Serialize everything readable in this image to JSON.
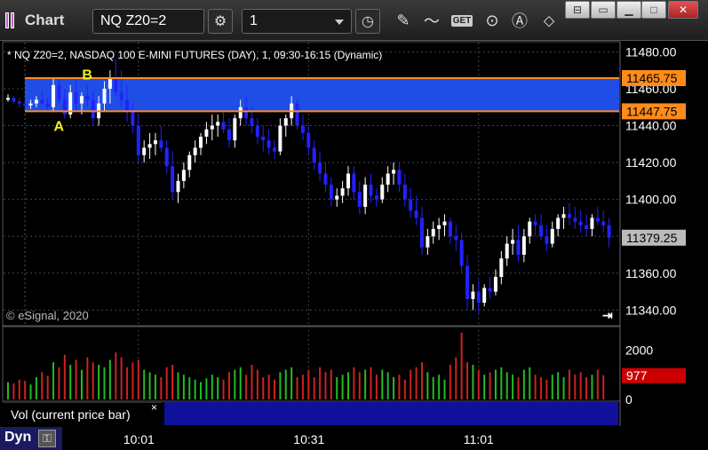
{
  "window": {
    "title": "Chart"
  },
  "toolbar": {
    "symbol": "NQ Z20=2",
    "interval": "1",
    "icons": [
      "settings-gear-icon",
      "clock-icon",
      "pencil-draw-icon",
      "study-icon",
      "get-icon",
      "play-icon",
      "autoscale-icon",
      "pointer-tool-icon"
    ],
    "get_label": "GET"
  },
  "window_controls": [
    "restore-icon",
    "minimize-icon",
    "maximize-icon",
    "close-icon"
  ],
  "chart_header": "* NQ Z20=2, NASDAQ 100 E-MINI FUTURES (DAY), 1, 09:30-16:15 (Dynamic)",
  "copyright": "© eSignal, 2020",
  "volume_panel": {
    "label": "Vol (current price bar)",
    "close_glyph": "×"
  },
  "status": {
    "mode": "Dyn"
  },
  "colors": {
    "up": "#ffffff",
    "down": "#2222ff",
    "zone": "#2255ff",
    "line": "#ff8c19",
    "vol_up": "#22bb22",
    "vol_down": "#cc2222"
  },
  "chart_data": [
    {
      "type": "candlestick",
      "title": "",
      "y_ticks": [
        11340,
        11360,
        11380,
        11400,
        11420,
        11440,
        11460,
        11480
      ],
      "y_tick_labels": [
        "11340.00",
        "11360.00",
        "11380.00",
        "11400.00",
        "11420.00",
        "11440.00",
        "11460.00",
        "11480.00"
      ],
      "ylim": [
        11332,
        11485
      ],
      "x_tick_labels": [
        "10:01",
        "10:31",
        "11:01"
      ],
      "price_markers": [
        {
          "value": 11465.75,
          "label": "11465.75",
          "kind": "level"
        },
        {
          "value": 11447.75,
          "label": "11447.75",
          "kind": "level"
        },
        {
          "value": 11379.25,
          "label": "11379.25",
          "kind": "last"
        }
      ],
      "zone": {
        "from": 11447.75,
        "to": 11465.75
      },
      "annotations": [
        {
          "text": "A",
          "x": 9,
          "y": 11440
        },
        {
          "text": "B",
          "x": 14,
          "y": 11468
        }
      ],
      "bars": [
        [
          11454,
          11457,
          11453,
          11455
        ],
        [
          11455,
          11456,
          11452,
          11453
        ],
        [
          11453,
          11455,
          11450,
          11452
        ],
        [
          11452,
          11454,
          11449,
          11451
        ],
        [
          11451,
          11454,
          11449,
          11452
        ],
        [
          11452,
          11456,
          11450,
          11454
        ],
        [
          11454,
          11458,
          11451,
          11452
        ],
        [
          11452,
          11455,
          11448,
          11450
        ],
        [
          11450,
          11466,
          11448,
          11462
        ],
        [
          11462,
          11466,
          11452,
          11454
        ],
        [
          11454,
          11460,
          11444,
          11446
        ],
        [
          11446,
          11462,
          11444,
          11458
        ],
        [
          11458,
          11466,
          11448,
          11452
        ],
        [
          11452,
          11458,
          11446,
          11456
        ],
        [
          11456,
          11462,
          11450,
          11454
        ],
        [
          11454,
          11458,
          11440,
          11444
        ],
        [
          11444,
          11456,
          11440,
          11452
        ],
        [
          11452,
          11464,
          11448,
          11460
        ],
        [
          11460,
          11470,
          11452,
          11466
        ],
        [
          11466,
          11476,
          11456,
          11458
        ],
        [
          11458,
          11470,
          11450,
          11454
        ],
        [
          11454,
          11462,
          11442,
          11448
        ],
        [
          11448,
          11452,
          11436,
          11440
        ],
        [
          11440,
          11446,
          11420,
          11424
        ],
        [
          11424,
          11432,
          11420,
          11428
        ],
        [
          11428,
          11436,
          11422,
          11430
        ],
        [
          11430,
          11436,
          11424,
          11432
        ],
        [
          11432,
          11440,
          11426,
          11428
        ],
        [
          11428,
          11432,
          11414,
          11418
        ],
        [
          11418,
          11426,
          11400,
          11404
        ],
        [
          11404,
          11414,
          11398,
          11410
        ],
        [
          11410,
          11420,
          11406,
          11416
        ],
        [
          11416,
          11426,
          11412,
          11424
        ],
        [
          11424,
          11432,
          11420,
          11428
        ],
        [
          11428,
          11436,
          11424,
          11434
        ],
        [
          11434,
          11442,
          11430,
          11438
        ],
        [
          11438,
          11446,
          11432,
          11440
        ],
        [
          11440,
          11446,
          11434,
          11442
        ],
        [
          11442,
          11448,
          11436,
          11438
        ],
        [
          11438,
          11444,
          11428,
          11432
        ],
        [
          11432,
          11446,
          11428,
          11444
        ],
        [
          11444,
          11454,
          11440,
          11450
        ],
        [
          11450,
          11456,
          11440,
          11444
        ],
        [
          11444,
          11450,
          11436,
          11440
        ],
        [
          11440,
          11444,
          11430,
          11434
        ],
        [
          11434,
          11440,
          11426,
          11432
        ],
        [
          11432,
          11438,
          11424,
          11428
        ],
        [
          11428,
          11432,
          11422,
          11426
        ],
        [
          11426,
          11444,
          11424,
          11440
        ],
        [
          11440,
          11446,
          11434,
          11444
        ],
        [
          11444,
          11456,
          11440,
          11452
        ],
        [
          11452,
          11454,
          11438,
          11440
        ],
        [
          11440,
          11446,
          11432,
          11436
        ],
        [
          11436,
          11440,
          11424,
          11428
        ],
        [
          11428,
          11432,
          11416,
          11420
        ],
        [
          11420,
          11426,
          11410,
          11414
        ],
        [
          11414,
          11420,
          11404,
          11408
        ],
        [
          11408,
          11412,
          11396,
          11400
        ],
        [
          11400,
          11406,
          11396,
          11402
        ],
        [
          11402,
          11410,
          11398,
          11406
        ],
        [
          11406,
          11418,
          11402,
          11414
        ],
        [
          11414,
          11418,
          11400,
          11404
        ],
        [
          11404,
          11410,
          11392,
          11396
        ],
        [
          11396,
          11412,
          11392,
          11408
        ],
        [
          11408,
          11414,
          11398,
          11402
        ],
        [
          11402,
          11406,
          11396,
          11400
        ],
        [
          11400,
          11412,
          11398,
          11408
        ],
        [
          11408,
          11418,
          11404,
          11414
        ],
        [
          11414,
          11420,
          11408,
          11416
        ],
        [
          11416,
          11420,
          11404,
          11408
        ],
        [
          11408,
          11414,
          11396,
          11400
        ],
        [
          11400,
          11406,
          11390,
          11394
        ],
        [
          11394,
          11402,
          11386,
          11390
        ],
        [
          11390,
          11396,
          11370,
          11374
        ],
        [
          11374,
          11384,
          11370,
          11380
        ],
        [
          11380,
          11388,
          11376,
          11384
        ],
        [
          11384,
          11390,
          11378,
          11386
        ],
        [
          11386,
          11392,
          11380,
          11388
        ],
        [
          11388,
          11390,
          11376,
          11380
        ],
        [
          11380,
          11386,
          11372,
          11378
        ],
        [
          11378,
          11382,
          11360,
          11364
        ],
        [
          11364,
          11370,
          11340,
          11346
        ],
        [
          11346,
          11354,
          11340,
          11350
        ],
        [
          11350,
          11356,
          11338,
          11344
        ],
        [
          11344,
          11354,
          11342,
          11352
        ],
        [
          11352,
          11358,
          11346,
          11350
        ],
        [
          11350,
          11362,
          11348,
          11358
        ],
        [
          11358,
          11372,
          11354,
          11368
        ],
        [
          11368,
          11380,
          11364,
          11376
        ],
        [
          11376,
          11384,
          11370,
          11378
        ],
        [
          11378,
          11386,
          11366,
          11370
        ],
        [
          11370,
          11384,
          11366,
          11380
        ],
        [
          11380,
          11390,
          11376,
          11388
        ],
        [
          11388,
          11392,
          11380,
          11386
        ],
        [
          11386,
          11392,
          11378,
          11380
        ],
        [
          11380,
          11386,
          11372,
          11376
        ],
        [
          11376,
          11388,
          11374,
          11384
        ],
        [
          11384,
          11392,
          11380,
          11390
        ],
        [
          11390,
          11396,
          11384,
          11392
        ],
        [
          11392,
          11398,
          11386,
          11390
        ],
        [
          11390,
          11396,
          11384,
          11388
        ],
        [
          11388,
          11394,
          11382,
          11386
        ],
        [
          11386,
          11392,
          11380,
          11384
        ],
        [
          11384,
          11392,
          11380,
          11390
        ],
        [
          11390,
          11396,
          11386,
          11388
        ],
        [
          11388,
          11394,
          11382,
          11386
        ],
        [
          11386,
          11390,
          11374,
          11379.25
        ]
      ]
    },
    {
      "type": "bar",
      "title": "Vol (current price bar)",
      "y_ticks": [
        0,
        2000
      ],
      "y_tick_labels": [
        "0",
        "2000"
      ],
      "ylim": [
        0,
        2800
      ],
      "last_value": 977,
      "last_label": "977",
      "values": [
        700,
        650,
        800,
        750,
        600,
        900,
        1100,
        950,
        1500,
        1300,
        1800,
        1400,
        1600,
        1200,
        1700,
        1500,
        1400,
        1300,
        1600,
        1900,
        1700,
        1300,
        1500,
        1600,
        1200,
        1100,
        1000,
        900,
        1300,
        1400,
        1100,
        1000,
        900,
        800,
        700,
        850,
        1000,
        900,
        800,
        1100,
        1200,
        1300,
        1000,
        1400,
        1200,
        900,
        1000,
        800,
        1100,
        1200,
        1300,
        900,
        1000,
        1200,
        900,
        1300,
        1100,
        1200,
        900,
        1000,
        1100,
        1300,
        1100,
        1200,
        1300,
        1000,
        1200,
        1100,
        900,
        1000,
        800,
        1200,
        1300,
        1500,
        1100,
        900,
        1000,
        800,
        1400,
        1700,
        2700,
        1500,
        1400,
        1200,
        1000,
        1100,
        1200,
        1300,
        1100,
        1000,
        900,
        1200,
        1300,
        1000,
        900,
        800,
        1000,
        1100,
        900,
        1200,
        1000,
        1100,
        900,
        1000,
        1200,
        977
      ]
    }
  ]
}
